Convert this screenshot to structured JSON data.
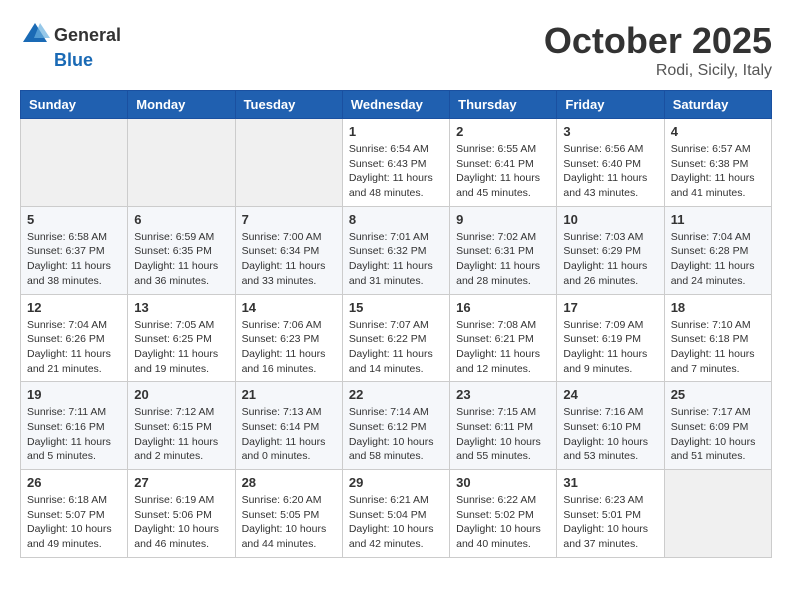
{
  "header": {
    "logo_general": "General",
    "logo_blue": "Blue",
    "month": "October 2025",
    "location": "Rodi, Sicily, Italy"
  },
  "weekdays": [
    "Sunday",
    "Monday",
    "Tuesday",
    "Wednesday",
    "Thursday",
    "Friday",
    "Saturday"
  ],
  "weeks": [
    [
      {
        "day": "",
        "info": ""
      },
      {
        "day": "",
        "info": ""
      },
      {
        "day": "",
        "info": ""
      },
      {
        "day": "1",
        "info": "Sunrise: 6:54 AM\nSunset: 6:43 PM\nDaylight: 11 hours\nand 48 minutes."
      },
      {
        "day": "2",
        "info": "Sunrise: 6:55 AM\nSunset: 6:41 PM\nDaylight: 11 hours\nand 45 minutes."
      },
      {
        "day": "3",
        "info": "Sunrise: 6:56 AM\nSunset: 6:40 PM\nDaylight: 11 hours\nand 43 minutes."
      },
      {
        "day": "4",
        "info": "Sunrise: 6:57 AM\nSunset: 6:38 PM\nDaylight: 11 hours\nand 41 minutes."
      }
    ],
    [
      {
        "day": "5",
        "info": "Sunrise: 6:58 AM\nSunset: 6:37 PM\nDaylight: 11 hours\nand 38 minutes."
      },
      {
        "day": "6",
        "info": "Sunrise: 6:59 AM\nSunset: 6:35 PM\nDaylight: 11 hours\nand 36 minutes."
      },
      {
        "day": "7",
        "info": "Sunrise: 7:00 AM\nSunset: 6:34 PM\nDaylight: 11 hours\nand 33 minutes."
      },
      {
        "day": "8",
        "info": "Sunrise: 7:01 AM\nSunset: 6:32 PM\nDaylight: 11 hours\nand 31 minutes."
      },
      {
        "day": "9",
        "info": "Sunrise: 7:02 AM\nSunset: 6:31 PM\nDaylight: 11 hours\nand 28 minutes."
      },
      {
        "day": "10",
        "info": "Sunrise: 7:03 AM\nSunset: 6:29 PM\nDaylight: 11 hours\nand 26 minutes."
      },
      {
        "day": "11",
        "info": "Sunrise: 7:04 AM\nSunset: 6:28 PM\nDaylight: 11 hours\nand 24 minutes."
      }
    ],
    [
      {
        "day": "12",
        "info": "Sunrise: 7:04 AM\nSunset: 6:26 PM\nDaylight: 11 hours\nand 21 minutes."
      },
      {
        "day": "13",
        "info": "Sunrise: 7:05 AM\nSunset: 6:25 PM\nDaylight: 11 hours\nand 19 minutes."
      },
      {
        "day": "14",
        "info": "Sunrise: 7:06 AM\nSunset: 6:23 PM\nDaylight: 11 hours\nand 16 minutes."
      },
      {
        "day": "15",
        "info": "Sunrise: 7:07 AM\nSunset: 6:22 PM\nDaylight: 11 hours\nand 14 minutes."
      },
      {
        "day": "16",
        "info": "Sunrise: 7:08 AM\nSunset: 6:21 PM\nDaylight: 11 hours\nand 12 minutes."
      },
      {
        "day": "17",
        "info": "Sunrise: 7:09 AM\nSunset: 6:19 PM\nDaylight: 11 hours\nand 9 minutes."
      },
      {
        "day": "18",
        "info": "Sunrise: 7:10 AM\nSunset: 6:18 PM\nDaylight: 11 hours\nand 7 minutes."
      }
    ],
    [
      {
        "day": "19",
        "info": "Sunrise: 7:11 AM\nSunset: 6:16 PM\nDaylight: 11 hours\nand 5 minutes."
      },
      {
        "day": "20",
        "info": "Sunrise: 7:12 AM\nSunset: 6:15 PM\nDaylight: 11 hours\nand 2 minutes."
      },
      {
        "day": "21",
        "info": "Sunrise: 7:13 AM\nSunset: 6:14 PM\nDaylight: 11 hours\nand 0 minutes."
      },
      {
        "day": "22",
        "info": "Sunrise: 7:14 AM\nSunset: 6:12 PM\nDaylight: 10 hours\nand 58 minutes."
      },
      {
        "day": "23",
        "info": "Sunrise: 7:15 AM\nSunset: 6:11 PM\nDaylight: 10 hours\nand 55 minutes."
      },
      {
        "day": "24",
        "info": "Sunrise: 7:16 AM\nSunset: 6:10 PM\nDaylight: 10 hours\nand 53 minutes."
      },
      {
        "day": "25",
        "info": "Sunrise: 7:17 AM\nSunset: 6:09 PM\nDaylight: 10 hours\nand 51 minutes."
      }
    ],
    [
      {
        "day": "26",
        "info": "Sunrise: 6:18 AM\nSunset: 5:07 PM\nDaylight: 10 hours\nand 49 minutes."
      },
      {
        "day": "27",
        "info": "Sunrise: 6:19 AM\nSunset: 5:06 PM\nDaylight: 10 hours\nand 46 minutes."
      },
      {
        "day": "28",
        "info": "Sunrise: 6:20 AM\nSunset: 5:05 PM\nDaylight: 10 hours\nand 44 minutes."
      },
      {
        "day": "29",
        "info": "Sunrise: 6:21 AM\nSunset: 5:04 PM\nDaylight: 10 hours\nand 42 minutes."
      },
      {
        "day": "30",
        "info": "Sunrise: 6:22 AM\nSunset: 5:02 PM\nDaylight: 10 hours\nand 40 minutes."
      },
      {
        "day": "31",
        "info": "Sunrise: 6:23 AM\nSunset: 5:01 PM\nDaylight: 10 hours\nand 37 minutes."
      },
      {
        "day": "",
        "info": ""
      }
    ]
  ]
}
